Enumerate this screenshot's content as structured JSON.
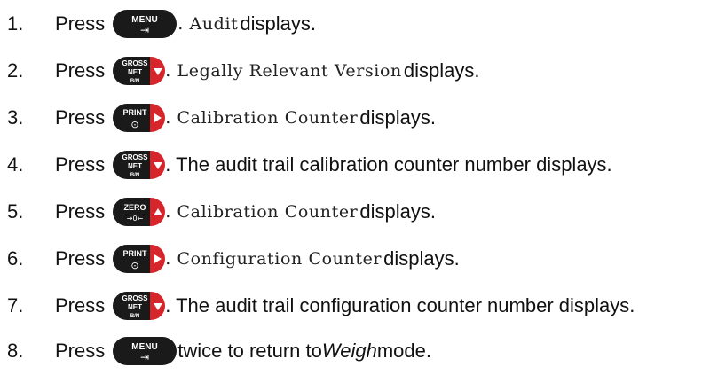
{
  "colors": {
    "key_body": "#1a1a1a",
    "key_accent": "#d7262b",
    "key_text": "#ffffff"
  },
  "steps": [
    {
      "num": "1.",
      "press": "Press",
      "key": "MENU",
      "icon": "menu-key-icon",
      "text_mono": ". Audit",
      "text_tail": " displays."
    },
    {
      "num": "2.",
      "press": "Press",
      "key": "GROSS NET B/N",
      "icon": "gross-net-down-key-icon",
      "text_mono": ". Legally Relevant Version",
      "text_tail": " displays."
    },
    {
      "num": "3.",
      "press": "Press",
      "key": "PRINT",
      "icon": "print-right-key-icon",
      "text_mono": ". Calibration Counter",
      "text_tail": " displays."
    },
    {
      "num": "4.",
      "press": "Press",
      "key": "GROSS NET B/N",
      "icon": "gross-net-down-key-icon",
      "text_plain": ". The audit trail calibration counter number displays."
    },
    {
      "num": "5.",
      "press": "Press",
      "key": "ZERO",
      "icon": "zero-up-key-icon",
      "text_mono": ". Calibration Counter",
      "text_tail": " displays."
    },
    {
      "num": "6.",
      "press": "Press",
      "key": "PRINT",
      "icon": "print-right-key-icon",
      "text_mono": ". Configuration Counter",
      "text_tail": " displays."
    },
    {
      "num": "7.",
      "press": "Press",
      "key": "GROSS NET B/N",
      "icon": "gross-net-down-key-icon",
      "text_plain": ". The audit trail configuration counter number displays."
    },
    {
      "num": "8.",
      "press": "Press",
      "key": "MENU",
      "icon": "menu-key-icon",
      "text_plain": " twice to return to ",
      "text_italic": "Weigh",
      "text_end": " mode."
    }
  ],
  "keys": {
    "menu": {
      "line1": "MENU",
      "symbol": "⇥"
    },
    "gross": {
      "line1": "GROSS",
      "line2": "NET",
      "line3": "B/N"
    },
    "print": {
      "line1": "PRINT",
      "symbol": "⊙"
    },
    "zero": {
      "line1": "ZERO",
      "line2": "→0←"
    }
  }
}
